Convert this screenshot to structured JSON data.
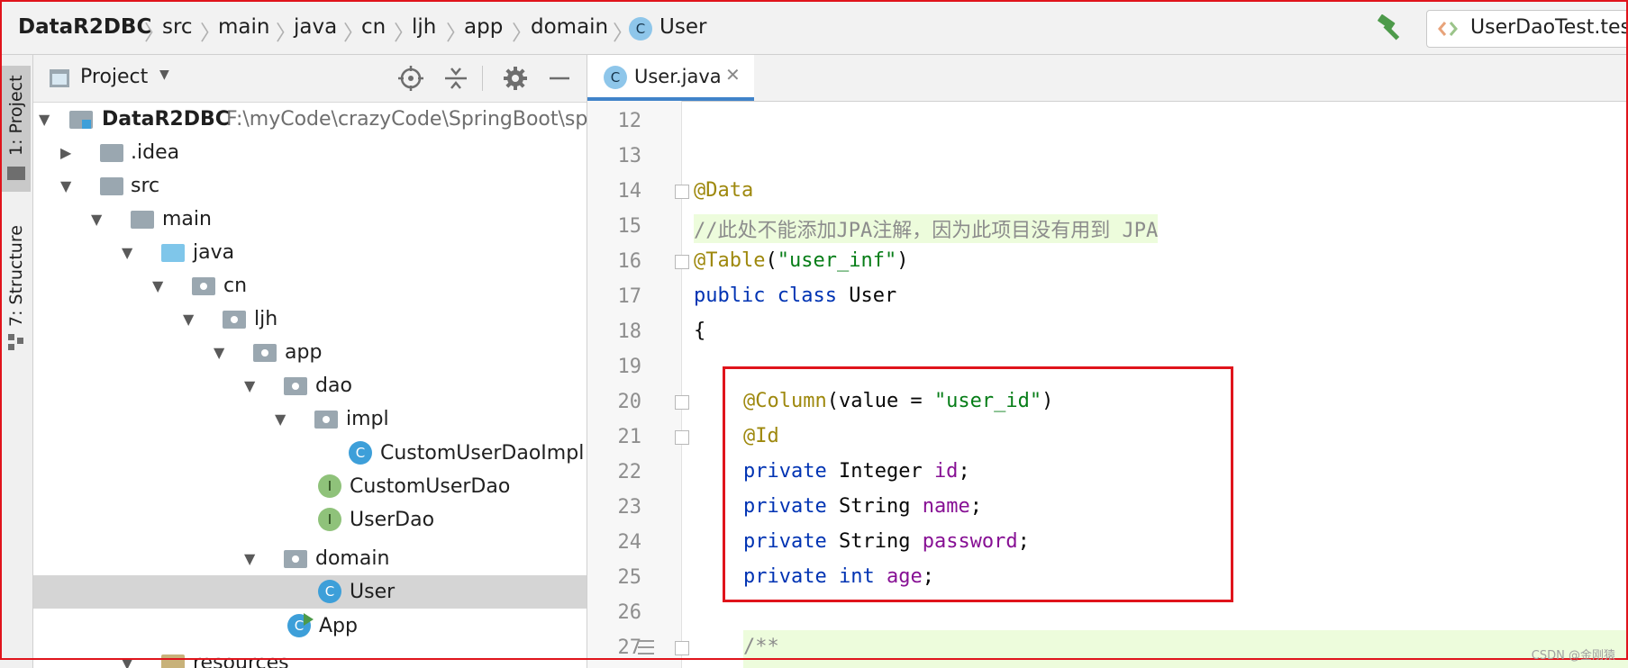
{
  "breadcrumb": {
    "items": [
      "DataR2DBC",
      "src",
      "main",
      "java",
      "cn",
      "ljh",
      "app",
      "domain",
      "User"
    ]
  },
  "run_config": {
    "label": "UserDaoTest.test"
  },
  "toolstrip": {
    "project_tab": "1: Project",
    "structure_tab": "7: Structure"
  },
  "project_panel": {
    "title": "Project",
    "tree": [
      {
        "label": "DataR2DBC",
        "path": "F:\\myCode\\crazyCode\\SpringBoot\\spr"
      },
      {
        "label": ".idea"
      },
      {
        "label": "src"
      },
      {
        "label": "main"
      },
      {
        "label": "java"
      },
      {
        "label": "cn"
      },
      {
        "label": "ljh"
      },
      {
        "label": "app"
      },
      {
        "label": "dao"
      },
      {
        "label": "impl"
      },
      {
        "label": "CustomUserDaoImpl"
      },
      {
        "label": "CustomUserDao"
      },
      {
        "label": "UserDao"
      },
      {
        "label": "domain"
      },
      {
        "label": "User"
      },
      {
        "label": "App"
      },
      {
        "label": "resources"
      }
    ]
  },
  "editor": {
    "tab_label": "User.java",
    "line_numbers": [
      "12",
      "13",
      "14",
      "15",
      "16",
      "17",
      "18",
      "19",
      "20",
      "21",
      "22",
      "23",
      "24",
      "25",
      "26",
      "27"
    ],
    "lines": {
      "l14": "@Data",
      "l15": "//此处不能添加JPA注解，因为此项目没有用到 JPA",
      "l16_ann": "@Table",
      "l16_open": "(",
      "l16_str": "\"user_inf\"",
      "l16_close": ")",
      "l17_kw1": "public",
      "l17_kw2": "class",
      "l17_name": "User",
      "l18": "{",
      "l20_ann": "@Column",
      "l20_mid": "(value = ",
      "l20_str": "\"user_id\"",
      "l20_close": ")",
      "l21": "@Id",
      "l22_kw": "private",
      "l22_type": "Integer",
      "l22_fld": "id",
      "l23_kw": "private",
      "l23_type": "String",
      "l23_fld": "name",
      "l24_kw": "private",
      "l24_type": "String",
      "l24_fld": "password",
      "l25_kw": "private",
      "l25_type": "int",
      "l25_fld": "age",
      "semicolon": ";",
      "l27": "/**"
    }
  },
  "watermark": "CSDN @金刚猿",
  "colors": {
    "accent": "#3d9fd9",
    "highlight": "#e0141c",
    "selection": "#d5d5d5"
  }
}
